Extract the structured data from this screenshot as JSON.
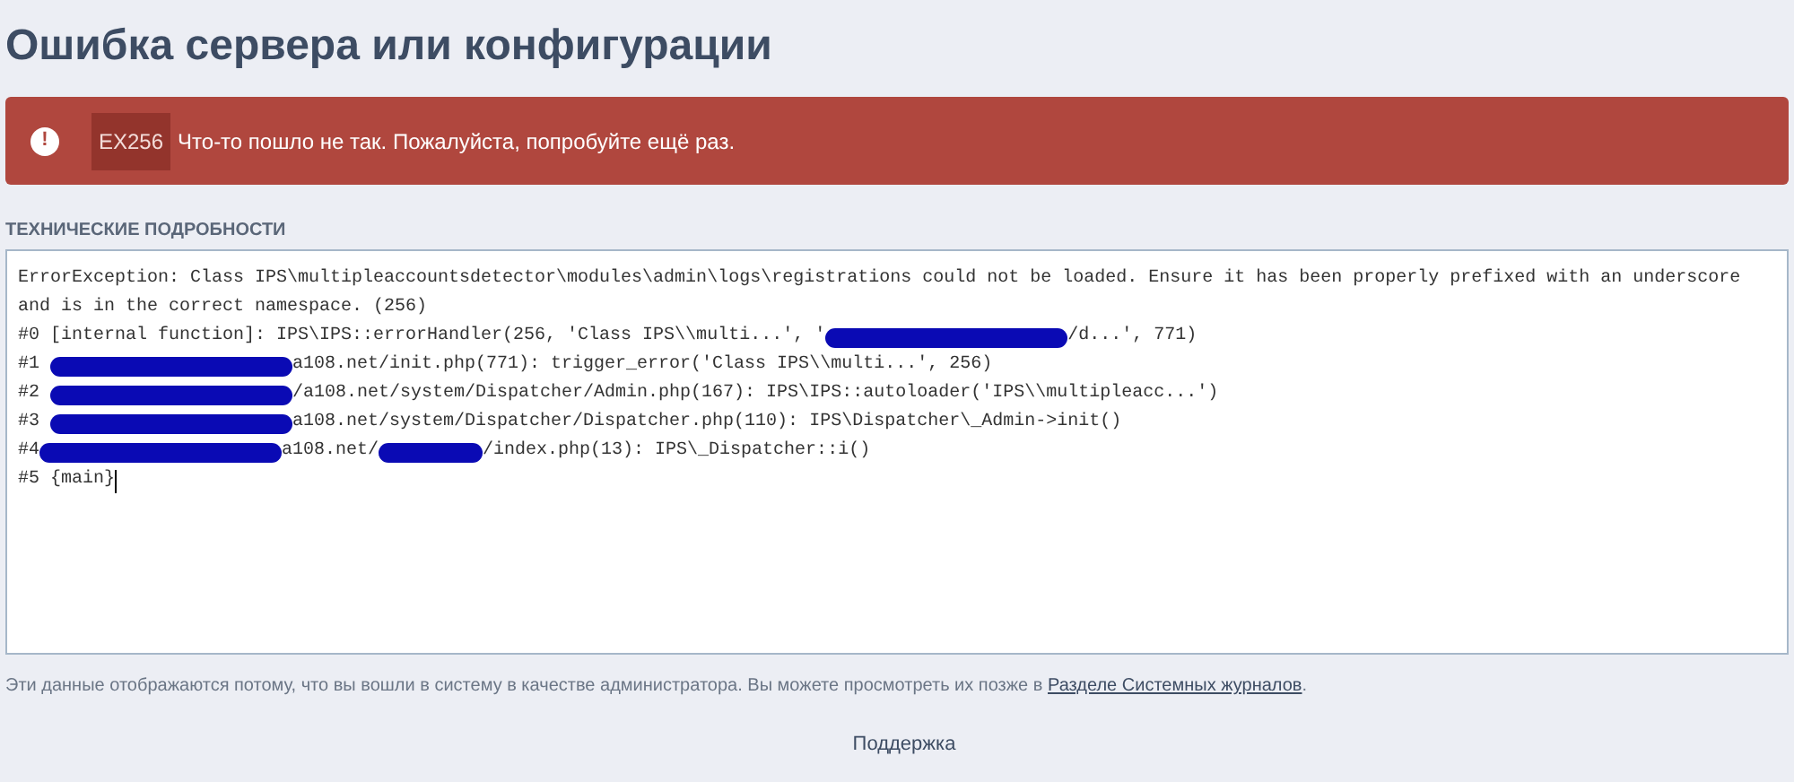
{
  "page_title": "Ошибка сервера или конфигурации",
  "alert": {
    "icon": "!",
    "code": "EX256",
    "message": "Что-то пошло не так. Пожалуйста, попробуйте ещё раз."
  },
  "details": {
    "heading": "ТЕХНИЧЕСКИЕ ПОДРОБНОСТИ",
    "message": "ErrorException: Class IPS\\multipleaccountsdetector\\modules\\admin\\logs\\registrations could not be loaded. Ensure it has been properly prefixed with an underscore and is in the correct namespace. (256)",
    "trace": [
      {
        "cursor": false,
        "segments": [
          {
            "kind": "text",
            "text": "#0 [internal function]: IPS\\IPS::errorHandler(256, 'Class IPS\\\\multi...', '"
          },
          {
            "kind": "redaction"
          },
          {
            "kind": "text",
            "text": "/d...', 771)"
          }
        ]
      },
      {
        "cursor": false,
        "segments": [
          {
            "kind": "text",
            "text": "#1 "
          },
          {
            "kind": "redaction"
          },
          {
            "kind": "text",
            "text": "a108.net/init.php(771): trigger_error('Class IPS\\\\multi...', 256)"
          }
        ]
      },
      {
        "cursor": false,
        "segments": [
          {
            "kind": "text",
            "text": "#2 "
          },
          {
            "kind": "redaction"
          },
          {
            "kind": "text",
            "text": "/a108.net/system/Dispatcher/Admin.php(167): IPS\\IPS::autoloader('IPS\\\\multipleacc...')"
          }
        ]
      },
      {
        "cursor": false,
        "segments": [
          {
            "kind": "text",
            "text": "#3 "
          },
          {
            "kind": "redaction"
          },
          {
            "kind": "text",
            "text": "a108.net/system/Dispatcher/Dispatcher.php(110): IPS\\Dispatcher\\_Admin->init()"
          }
        ]
      },
      {
        "cursor": false,
        "segments": [
          {
            "kind": "text",
            "text": "#4"
          },
          {
            "kind": "redaction"
          },
          {
            "kind": "text",
            "text": "a108.net/"
          },
          {
            "kind": "redaction"
          },
          {
            "kind": "text",
            "text": "/index.php(13): IPS\\_Dispatcher::i()"
          }
        ]
      },
      {
        "cursor": true,
        "segments": [
          {
            "kind": "text",
            "text": "#5 {main}"
          }
        ]
      }
    ]
  },
  "footer_note": {
    "text": "Эти данные отображаются потому, что вы вошли в систему в качестве администратора. Вы можете просмотреть их позже в ",
    "link": "Разделе Системных журналов",
    "end": "."
  },
  "support_link": "Поддержка"
}
